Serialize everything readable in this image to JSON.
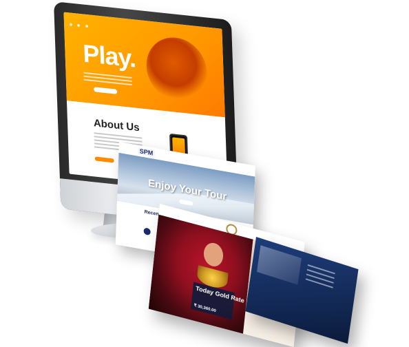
{
  "monitor_site": {
    "hero_title": "Play.",
    "section_label": "",
    "about_title": "About Us"
  },
  "travel_site": {
    "logo": "SPM",
    "hero_title": "Enjoy Your Tour",
    "section_title": "Recent Travel Articles"
  },
  "gold_site": {
    "rate_title": "Today Gold Rate",
    "rate_value": "₹ 30,360.00"
  },
  "colors": {
    "accent_orange": "#ff9800",
    "travel_navy": "#1b2a6b",
    "gold_red": "#b8142a",
    "dark_blue": "#132a57"
  }
}
